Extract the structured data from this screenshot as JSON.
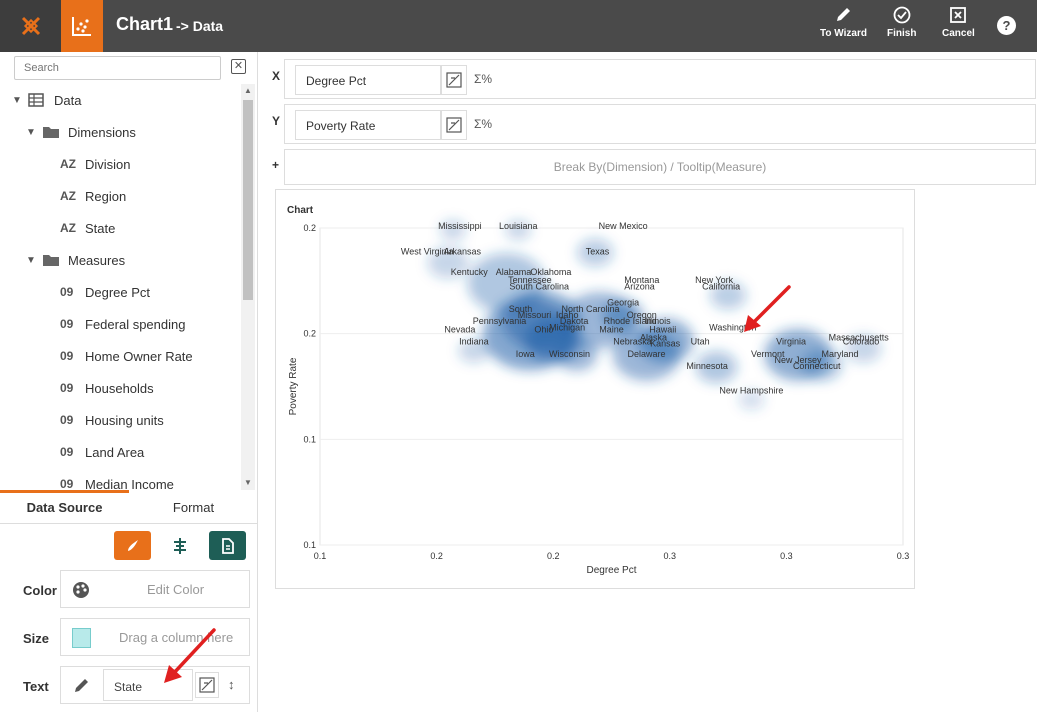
{
  "header": {
    "title": "Chart1",
    "subtitle": "-> Data",
    "to_wizard": "To Wizard",
    "finish": "Finish",
    "cancel": "Cancel",
    "help": "?"
  },
  "search": {
    "placeholder": "Search"
  },
  "tree": {
    "root": "Data",
    "dimensions_label": "Dimensions",
    "dimensions": [
      "Division",
      "Region",
      "State"
    ],
    "measures_label": "Measures",
    "measures": [
      "Degree Pct",
      "Federal spending",
      "Home Owner Rate",
      "Households",
      "Housing units",
      "Land Area",
      "Median Income"
    ],
    "dim_prefix": "AZ",
    "mea_prefix": "09"
  },
  "tabs": {
    "data_source": "Data Source",
    "format": "Format"
  },
  "props": {
    "color_label": "Color",
    "color_placeholder": "Edit Color",
    "size_label": "Size",
    "size_placeholder": "Drag a column here",
    "text_label": "Text",
    "text_value": "State"
  },
  "axes": {
    "x_key": "X",
    "x_field": "Degree Pct",
    "y_key": "Y",
    "y_field": "Poverty Rate",
    "plus": "+",
    "break_by": "Break By(Dimension) / Tooltip(Measure)",
    "sigma": "Σ%"
  },
  "colors": {
    "accent": "#e8701a",
    "topbar": "#4a4a4a",
    "teal": "#1e5e56",
    "density": "#1f5fa8"
  },
  "chart_data": {
    "type": "scatter",
    "title": "Chart",
    "xlabel": "Degree Pct",
    "ylabel": "Poverty Rate",
    "x_ticks": [
      "0.1",
      "0.2",
      "0.2",
      "0.3",
      "0.3",
      "0.3"
    ],
    "y_ticks": [
      "0.2",
      "0.2",
      "0.1",
      "0.1"
    ],
    "xlim": [
      0.15,
      0.4
    ],
    "ylim": [
      0.06,
      0.215
    ],
    "points": [
      {
        "label": "Mississippi",
        "x": 0.21,
        "y": 0.2145
      },
      {
        "label": "Louisiana",
        "x": 0.235,
        "y": 0.2145
      },
      {
        "label": "New Mexico",
        "x": 0.28,
        "y": 0.2145
      },
      {
        "label": "West Virginia",
        "x": 0.196,
        "y": 0.202
      },
      {
        "label": "Arkansas",
        "x": 0.211,
        "y": 0.202
      },
      {
        "label": "Texas",
        "x": 0.269,
        "y": 0.202
      },
      {
        "label": "Kentucky",
        "x": 0.214,
        "y": 0.192
      },
      {
        "label": "Alabama",
        "x": 0.233,
        "y": 0.192
      },
      {
        "label": "Oklahoma",
        "x": 0.249,
        "y": 0.192
      },
      {
        "label": "Tennessee",
        "x": 0.24,
        "y": 0.188
      },
      {
        "label": "Montana",
        "x": 0.288,
        "y": 0.188
      },
      {
        "label": "New York",
        "x": 0.319,
        "y": 0.188
      },
      {
        "label": "South Carolina",
        "x": 0.244,
        "y": 0.185
      },
      {
        "label": "Arizona",
        "x": 0.287,
        "y": 0.185
      },
      {
        "label": "California",
        "x": 0.322,
        "y": 0.185
      },
      {
        "label": "Georgia",
        "x": 0.28,
        "y": 0.177
      },
      {
        "label": "South",
        "x": 0.236,
        "y": 0.174
      },
      {
        "label": "North Carolina",
        "x": 0.266,
        "y": 0.174
      },
      {
        "label": "Missouri",
        "x": 0.242,
        "y": 0.171
      },
      {
        "label": "Idaho",
        "x": 0.256,
        "y": 0.171
      },
      {
        "label": "Oregon",
        "x": 0.288,
        "y": 0.171
      },
      {
        "label": "Pennsylvania",
        "x": 0.227,
        "y": 0.168
      },
      {
        "label": "Dakota",
        "x": 0.259,
        "y": 0.168
      },
      {
        "label": "Rhode Island",
        "x": 0.283,
        "y": 0.168
      },
      {
        "label": "Illinois",
        "x": 0.295,
        "y": 0.168
      },
      {
        "label": "Nevada",
        "x": 0.21,
        "y": 0.164
      },
      {
        "label": "Ohio",
        "x": 0.246,
        "y": 0.164
      },
      {
        "label": "Michigan",
        "x": 0.256,
        "y": 0.165
      },
      {
        "label": "Maine",
        "x": 0.275,
        "y": 0.164
      },
      {
        "label": "Hawaii",
        "x": 0.297,
        "y": 0.164
      },
      {
        "label": "Washington",
        "x": 0.327,
        "y": 0.165
      },
      {
        "label": "Alaska",
        "x": 0.293,
        "y": 0.16
      },
      {
        "label": "Massachusetts",
        "x": 0.381,
        "y": 0.16
      },
      {
        "label": "Indiana",
        "x": 0.216,
        "y": 0.158
      },
      {
        "label": "Nebraska",
        "x": 0.284,
        "y": 0.158
      },
      {
        "label": "Kansas",
        "x": 0.298,
        "y": 0.157
      },
      {
        "label": "Utah",
        "x": 0.313,
        "y": 0.158
      },
      {
        "label": "Virginia",
        "x": 0.352,
        "y": 0.158
      },
      {
        "label": "Colorado",
        "x": 0.382,
        "y": 0.158
      },
      {
        "label": "Iowa",
        "x": 0.238,
        "y": 0.152
      },
      {
        "label": "Wisconsin",
        "x": 0.257,
        "y": 0.152
      },
      {
        "label": "Delaware",
        "x": 0.29,
        "y": 0.152
      },
      {
        "label": "Vermont",
        "x": 0.342,
        "y": 0.152
      },
      {
        "label": "Maryland",
        "x": 0.373,
        "y": 0.152
      },
      {
        "label": "New Jersey",
        "x": 0.355,
        "y": 0.149
      },
      {
        "label": "Minnesota",
        "x": 0.316,
        "y": 0.146
      },
      {
        "label": "Connecticut",
        "x": 0.363,
        "y": 0.146
      },
      {
        "label": "New Hampshire",
        "x": 0.335,
        "y": 0.134
      }
    ]
  }
}
